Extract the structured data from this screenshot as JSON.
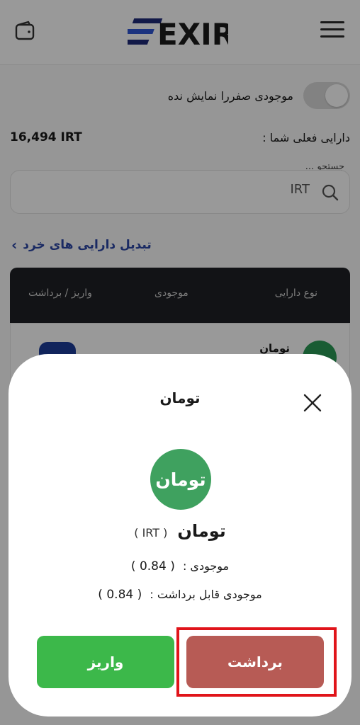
{
  "header": {
    "logo_text": "EXIR"
  },
  "filters": {
    "hide_zero_label": "موجودی صفررا نمایش نده"
  },
  "balance": {
    "label": "دارایی فعلی شما :",
    "value": "16,494 IRT"
  },
  "search": {
    "caption": "جستجو ...",
    "value": "IRT"
  },
  "convert_link": "تبدیل دارایی های خرد",
  "table": {
    "columns": [
      "نوع دارایی",
      "موجودی",
      "واریز / برداشت"
    ],
    "rows": [
      {
        "name": "تومان"
      }
    ]
  },
  "modal": {
    "title": "تومان",
    "coin_logo_text": "تومان",
    "coin_name": "تومان",
    "coin_symbol": "( IRT )",
    "balance_label": "موجودی :",
    "balance_value": "( 0.84 )",
    "withdrawable_label": "موجودی قابل برداشت :",
    "withdrawable_value": "( 0.84 )",
    "deposit_label": "واریز",
    "withdraw_label": "برداشت"
  },
  "colors": {
    "deposit": "#3cb84a",
    "withdraw": "#b75b55",
    "highlight": "#e0141a",
    "coin": "#3fa15f",
    "link": "#2c46a6"
  }
}
